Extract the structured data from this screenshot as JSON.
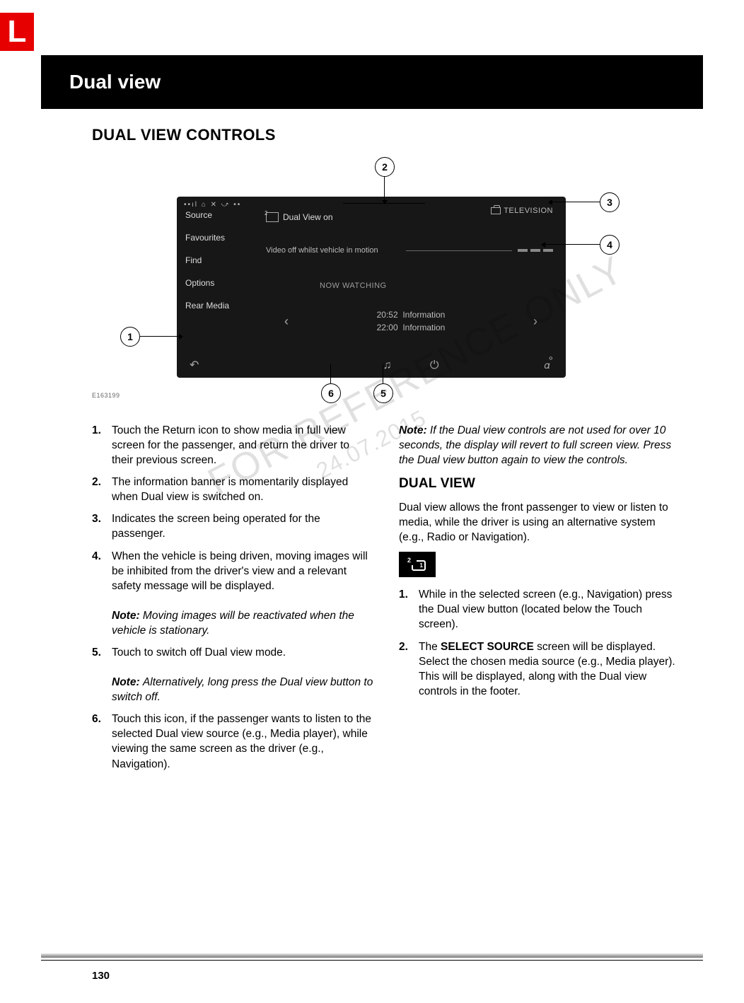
{
  "tab": "L",
  "header_title": "Dual view",
  "section_title": "DUAL VIEW CONTROLS",
  "figure_id": "E163199",
  "screenshot": {
    "sidebar": [
      "Source",
      "Favourites",
      "Find",
      "Options",
      "Rear Media"
    ],
    "banner": "Dual View on",
    "tv_label": "TELEVISION",
    "video_off": "Video off whilst vehicle in motion",
    "now_watching": "NOW WATCHING",
    "row1_time": "20:52",
    "row1_text": "Information",
    "row2_time": "22:00",
    "row2_text": "Information"
  },
  "callouts": {
    "c1": "1",
    "c2": "2",
    "c3": "3",
    "c4": "4",
    "c5": "5",
    "c6": "6"
  },
  "left_list": [
    {
      "n": "1.",
      "t": "Touch the Return icon to show media in full view screen for the passenger, and return the driver to their previous screen."
    },
    {
      "n": "2.",
      "t": "The information banner is momentarily displayed when Dual view is switched on."
    },
    {
      "n": "3.",
      "t": "Indicates the screen being operated for the passenger."
    },
    {
      "n": "4.",
      "t": "When the vehicle is being driven, moving images will be inhibited from the driver's view and a relevant safety message will be displayed.",
      "note": "Moving images will be reactivated when the vehicle is stationary."
    },
    {
      "n": "5.",
      "t": "Touch to switch off Dual view mode.",
      "note": "Alternatively, long press the Dual view button to switch off."
    },
    {
      "n": "6.",
      "t": "Touch this icon, if the passenger wants to listen to the selected Dual view source (e.g., Media player), while viewing the same screen as the driver (e.g., Navigation)."
    }
  ],
  "note_label": "Note:",
  "right_top_note": "If the Dual view controls are not used for over 10 seconds, the display will revert to full screen view. Press the Dual view button again to view the controls.",
  "right_heading": "DUAL VIEW",
  "right_intro": "Dual view allows the front passenger to view or listen to media, while the driver is using an alternative system (e.g., Radio or Navigation).",
  "right_list": [
    {
      "n": "1.",
      "t": "While in the selected screen (e.g., Navigation) press the Dual view button (located below the Touch screen)."
    },
    {
      "n": "2.",
      "pre": "The ",
      "bold": "SELECT SOURCE",
      "post": " screen will be displayed. Select the chosen media source (e.g., Media player). This will be displayed, along with the Dual view controls in the footer."
    }
  ],
  "watermark_main": "FOR REFERENCE ONLY",
  "watermark_date": "24.07.2015",
  "page_number": "130"
}
